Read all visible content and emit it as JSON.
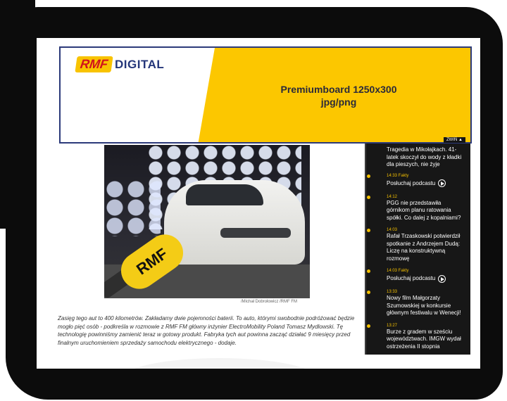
{
  "banner": {
    "logo_rmf": "RMF",
    "logo_digital": "DIGITAL",
    "line1": "Premiumboard 1250x300",
    "line2": "jpg/png"
  },
  "collapse_label": "ZWIŃ ▲",
  "photo": {
    "mic_text": "RMF",
    "caption": "/Michał Dobrołowicz /RMF FM"
  },
  "article": {
    "text": "Zasięg tego aut to 400 kilometrów. Zakładamy dwie pojemności baterii. To auto, którymi swobodnie podróżować będzie mogło pięć osób - podkreśla w rozmowie z RMF FM główny inżynier ElectroMobility Poland Tomasz Mydlowski. Tę technologię powinniśmy zamienić teraz w gotowy produkt. Fabryka tych aut powinna zacząć działać 9 miesięcy przed finalnym uruchomieniem sprzedaży samochodu elektrycznego - dodaje."
  },
  "sidebar": {
    "first_title": "Tragedia w Mikołajkach. 41-latek skoczył do wody z kładki dla pieszych, nie żyje",
    "items": [
      {
        "time": "14:33 Fakty",
        "title": "Posłuchaj podcastu"
      },
      {
        "time": "14:12",
        "title": "PGG nie przedstawiła górnikom planu ratowania spółki. Co dalej z kopalniami?"
      },
      {
        "time": "14:03",
        "title": "Rafał Trzaskowski potwierdził spotkanie z Andrzejem Dudą: Liczę na konstruktywną rozmowę"
      },
      {
        "time": "14:03 Fakty",
        "title": "Posłuchaj podcastu"
      },
      {
        "time": "13:33",
        "title": "Nowy film Małgorzaty Szumowskiej w konkursie głównym festiwalu w Wenecji!"
      },
      {
        "time": "13:27",
        "title": "Burze z gradem w sześciu województwach. IMGW wydał ostrzeżenia II stopnia"
      }
    ]
  },
  "colors": {
    "frame": "#0c0c0c",
    "accent": "#fcc700",
    "sidebar": "#171717",
    "banner_border": "#2c3a7a"
  }
}
